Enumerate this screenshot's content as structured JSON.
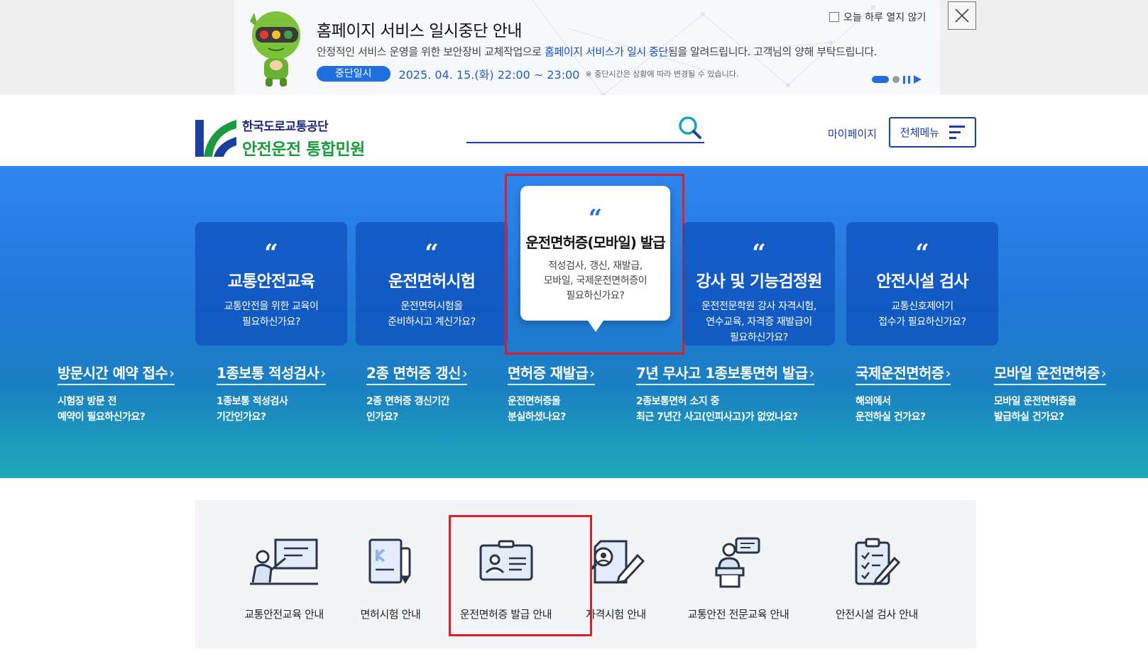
{
  "notice": {
    "title": "홈페이지 서비스 일시중단 안내",
    "desc_before": "안정적인 서비스 운영을 위한 보안장비 교체작업으로 ",
    "desc_highlight": "홈페이지 서비스가 일시 중단",
    "desc_after": "됨을 알려드립니다. 고객님의 양해 부탁드립니다.",
    "period_label": "중단일시",
    "period_time": "2025. 04. 15.(화) 22:00 ~ 23:00",
    "period_note": "※ 중단시간은 상황에 따라 변경될 수 있습니다.",
    "dont_show_today": "오늘 하루 열지 않기",
    "colors": {
      "accent": "#1f6fe0"
    }
  },
  "header": {
    "org_name": "한국도로교통공단",
    "site_name": "안전운전 통합민원",
    "search_placeholder": "",
    "mypage": "마이페이지",
    "all_menu": "전체메뉴"
  },
  "hero": {
    "cards": [
      {
        "title": "교통안전교육",
        "desc1": "교통안전을 위한 교육이",
        "desc2": "필요하신가요?",
        "desc3": ""
      },
      {
        "title": "운전면허시험",
        "desc1": "운전면허시험을",
        "desc2": "준비하시고 계신가요?",
        "desc3": ""
      },
      {
        "title": "운전면허증(모바일) 발급",
        "desc1": "적성검사, 갱신, 재발급,",
        "desc2": "모바일, 국제운전면허증이",
        "desc3": "필요하신가요?"
      },
      {
        "title": "강사 및 기능검정원",
        "desc1": "운전전문학원 강사 자격시험,",
        "desc2": "연수교육, 자격증 재발급이",
        "desc3": "필요하신가요?"
      },
      {
        "title": "안전시설 검사",
        "desc1": "교통신호제어기",
        "desc2": "접수가 필요하신가요?",
        "desc3": ""
      }
    ],
    "quick_links": [
      {
        "title": "방문시간 예약 접수",
        "desc1": "시험장 방문 전",
        "desc2": "예약이 필요하신가요?"
      },
      {
        "title": "1종보통 적성검사",
        "desc1": "1종보통 적성검사",
        "desc2": "기간인가요?"
      },
      {
        "title": "2종 면허증 갱신",
        "desc1": "2종 면허증 갱신기간",
        "desc2": "인가요?"
      },
      {
        "title": "면허증 재발급",
        "desc1": "운전면허증을",
        "desc2": "분실하셨나요?"
      },
      {
        "title": "7년 무사고 1종보통면허 발급",
        "desc1": "2종보통면허 소지 중",
        "desc2": "최근 7년간 사고(인피사고)가 없었나요?"
      },
      {
        "title": "국제운전면허증",
        "desc1": "해외에서",
        "desc2": "운전하실 건가요?"
      },
      {
        "title": "모바일 운전면허증",
        "desc1": "모바일 운전면허증을",
        "desc2": "발급하실 건가요?"
      }
    ]
  },
  "services": [
    {
      "label": "교통안전교육 안내",
      "icon": "teacher-board-icon"
    },
    {
      "label": "면허시험 안내",
      "icon": "document-pencil-icon"
    },
    {
      "label": "운전면허증 발급 안내",
      "icon": "id-card-icon"
    },
    {
      "label": "자격시험 안내",
      "icon": "exam-search-icon"
    },
    {
      "label": "교통안전 전문교육 안내",
      "icon": "lecturer-podium-icon"
    },
    {
      "label": "안전시설 검사 안내",
      "icon": "clipboard-checklist-icon"
    }
  ],
  "colors": {
    "brand_navy": "#1b3fa0",
    "brand_green": "#1a9c3e",
    "highlight_red": "#e01e2a"
  }
}
